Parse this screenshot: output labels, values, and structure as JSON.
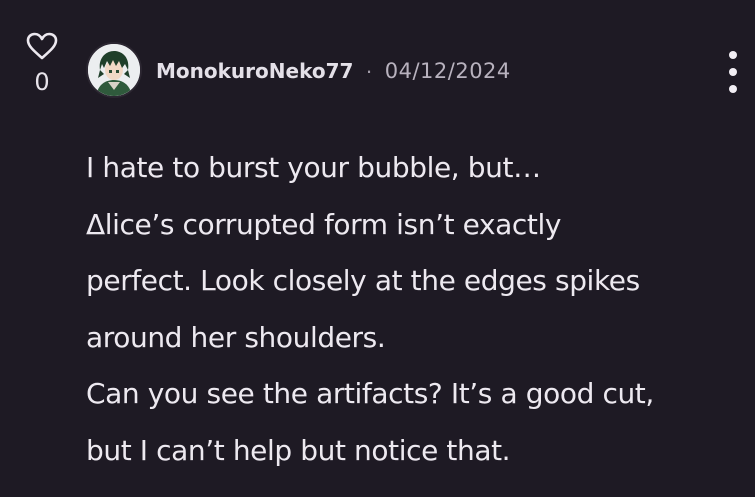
{
  "comment": {
    "likes": {
      "icon": "heart-outline-icon",
      "count": "0"
    },
    "author": {
      "avatar_icon": "avatar-green-haired-character",
      "username": "MonokuroNeko77",
      "separator": "·",
      "date": "04/12/2024"
    },
    "more_icon": "vertical-ellipsis-icon",
    "body_lines": [
      "I hate to burst your bubble, but…",
      "Δlice’s corrupted form isn’t exactly",
      "perfect. Look closely at the edges spikes",
      "around her shoulders.",
      "Can you see the artifacts? It’s a good cut,",
      "but I can’t help but notice that."
    ]
  },
  "colors": {
    "background": "#1e1a24",
    "text": "#ede9f0",
    "muted": "#b8b2be"
  }
}
